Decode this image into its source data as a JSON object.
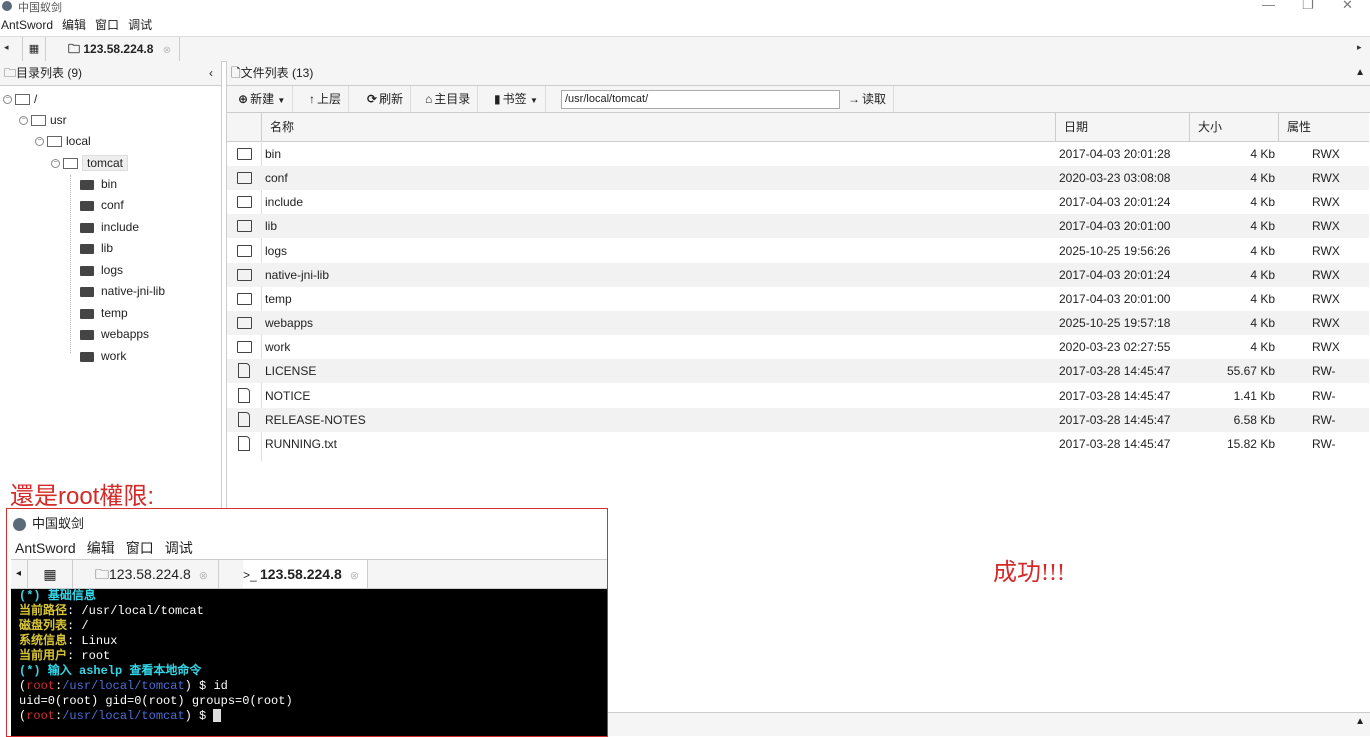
{
  "app": {
    "window_title": "中国蚁剑",
    "menu": [
      "AntSword",
      "编辑",
      "窗口",
      "调试"
    ],
    "window_controls": [
      "—",
      "❐",
      "✕"
    ]
  },
  "tabs": {
    "home_icon": "grid-icon",
    "active_tab": "123.58.224.8",
    "left_arrow": "◂",
    "right_arrow": "▸"
  },
  "dir_panel": {
    "title": "目录列表 (9)",
    "collapse": "‹",
    "tree": {
      "root": "/",
      "usr": "usr",
      "local": "local",
      "tomcat": "tomcat",
      "children": [
        "bin",
        "conf",
        "include",
        "lib",
        "logs",
        "native-jni-lib",
        "temp",
        "webapps",
        "work"
      ]
    }
  },
  "file_panel": {
    "title": "文件列表 (13)",
    "toolbar": {
      "new": "新建",
      "up": "上层",
      "refresh": "刷新",
      "home": "主目录",
      "bookmark": "书签",
      "path": "/usr/local/tomcat/",
      "read": "读取"
    },
    "columns": [
      "名称",
      "日期",
      "大小",
      "属性"
    ],
    "rows": [
      {
        "type": "folder",
        "name": "bin",
        "date": "2017-04-03 20:01:28",
        "size": "4 Kb",
        "attr": "RWX"
      },
      {
        "type": "folder",
        "name": "conf",
        "date": "2020-03-23 03:08:08",
        "size": "4 Kb",
        "attr": "RWX"
      },
      {
        "type": "folder",
        "name": "include",
        "date": "2017-04-03 20:01:24",
        "size": "4 Kb",
        "attr": "RWX"
      },
      {
        "type": "folder",
        "name": "lib",
        "date": "2017-04-03 20:01:00",
        "size": "4 Kb",
        "attr": "RWX"
      },
      {
        "type": "folder",
        "name": "logs",
        "date": "2025-10-25 19:56:26",
        "size": "4 Kb",
        "attr": "RWX"
      },
      {
        "type": "folder",
        "name": "native-jni-lib",
        "date": "2017-04-03 20:01:24",
        "size": "4 Kb",
        "attr": "RWX"
      },
      {
        "type": "folder",
        "name": "temp",
        "date": "2017-04-03 20:01:00",
        "size": "4 Kb",
        "attr": "RWX"
      },
      {
        "type": "folder",
        "name": "webapps",
        "date": "2025-10-25 19:57:18",
        "size": "4 Kb",
        "attr": "RWX"
      },
      {
        "type": "folder",
        "name": "work",
        "date": "2020-03-23 02:27:55",
        "size": "4 Kb",
        "attr": "RWX"
      },
      {
        "type": "file",
        "name": "LICENSE",
        "date": "2017-03-28 14:45:47",
        "size": "55.67 Kb",
        "attr": "RW-"
      },
      {
        "type": "file",
        "name": "NOTICE",
        "date": "2017-03-28 14:45:47",
        "size": "1.41 Kb",
        "attr": "RW-"
      },
      {
        "type": "file",
        "name": "RELEASE-NOTES",
        "date": "2017-03-28 14:45:47",
        "size": "6.58 Kb",
        "attr": "RW-"
      },
      {
        "type": "file",
        "name": "RUNNING.txt",
        "date": "2017-03-28 14:45:47",
        "size": "15.82 Kb",
        "attr": "RW-"
      }
    ]
  },
  "annotations": {
    "root_note": "還是root權限:",
    "success": "成功!!!"
  },
  "inset": {
    "window_title": "中国蚁剑",
    "menu": [
      "AntSword",
      "编辑",
      "窗口",
      "调试"
    ],
    "tab1": "123.58.224.8",
    "tab2": "123.58.224.8",
    "terminal": {
      "l1_prefix": "(*) ",
      "l1_text": "基础信息",
      "l2_label": "当前路径",
      "l2_value": ": /usr/local/tomcat",
      "l3_label": "磁盘列表",
      "l3_value": ": /",
      "l4_label": "系统信息",
      "l4_value": ": Linux",
      "l5_label": "当前用户",
      "l5_value": ": root",
      "l6": "(*) 输入 ashelp 查看本地命令",
      "prompt_user": "root",
      "prompt_path": "/usr/local/tomcat",
      "cmd1": "id",
      "output1": "uid=0(root) gid=0(root) groups=0(root)"
    }
  },
  "colors": {
    "annotation_red": "#d42a2a",
    "terminal_bg": "#000000",
    "terminal_cyan": "#33d6e8",
    "terminal_yellow": "#d8c536"
  }
}
